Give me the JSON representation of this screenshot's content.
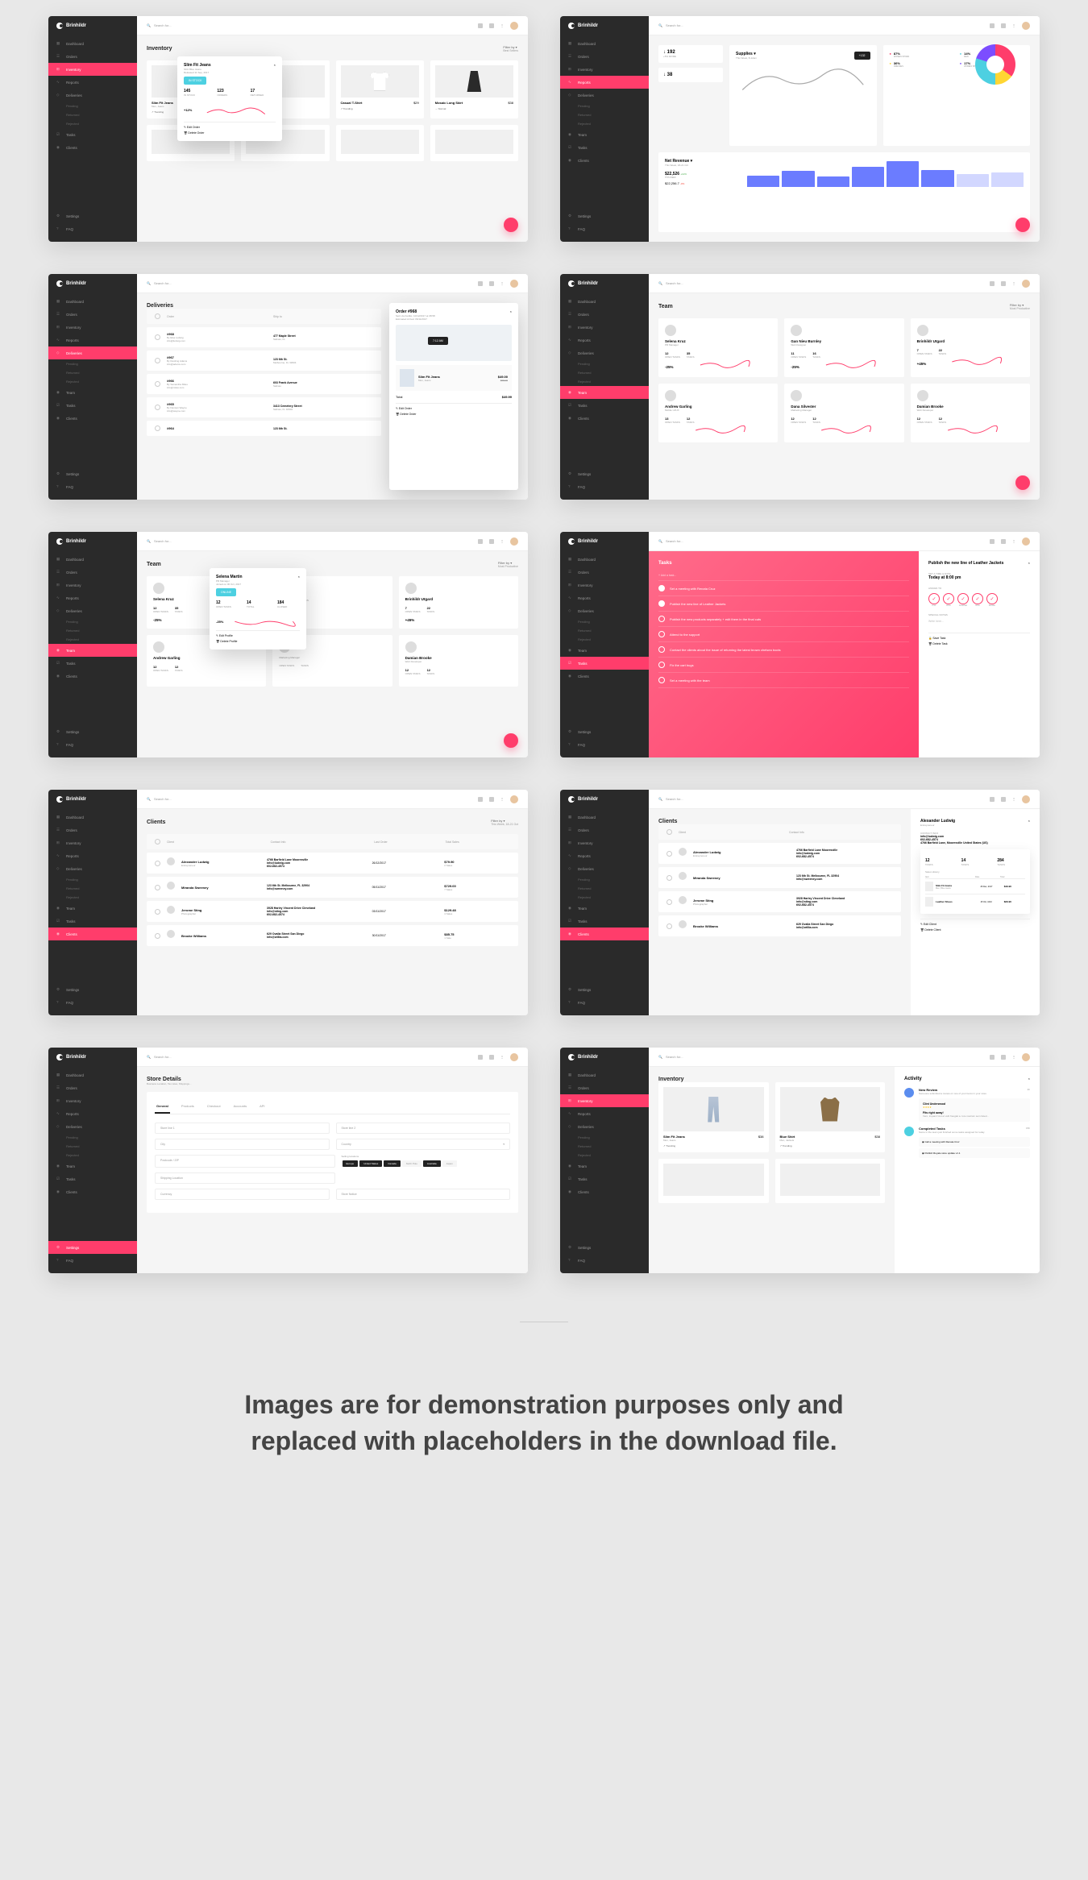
{
  "brand": "Brinhildr",
  "search_placeholder": "Search for...",
  "nav": {
    "dashboard": "Dashboard",
    "orders": "Orders",
    "inventory": "Inventory",
    "reports": "Reports",
    "deliveries": "Deliveries",
    "pending": "Pending",
    "returned": "Returned",
    "rejected": "Rejected",
    "team": "Team",
    "tasks": "Tasks",
    "clients": "Clients",
    "settings": "Settings",
    "faq": "FAQ"
  },
  "filter_label": "Filter by",
  "screens": {
    "s1": {
      "title": "Inventory",
      "filter_sub": "Best Sellers",
      "popup": {
        "name": "Slim Fit Jeans",
        "sku": "SKU Blue Jeans",
        "released": "Released 11 Sep, 2017",
        "badge": "IN STOCK",
        "stats": [
          {
            "val": "145",
            "lbl": "IN STOCK"
          },
          {
            "val": "123",
            "lbl": "ORDERS"
          },
          {
            "val": "17",
            "lbl": "RETURNED"
          }
        ],
        "trend": "+12%",
        "actions": [
          "Edit Order",
          "Delete Order"
        ]
      },
      "products": [
        {
          "name": "Slim Fit Jeans",
          "sub": "Men, Jeans",
          "price": "$38",
          "trend": "Trending"
        },
        {
          "name": "",
          "sub": "",
          "price": "",
          "trend": ""
        },
        {
          "name": "Casual T-Shirt",
          "sub": "",
          "price": "$29",
          "trend": "Trending"
        },
        {
          "name": "Mosaic Long Skirt",
          "sub": "",
          "price": "$38",
          "trend": "Normal"
        }
      ]
    },
    "s2": {
      "cards": [
        {
          "val": "192",
          "trend": "+5% MORE"
        },
        {
          "title": "Supplies",
          "sub": "This Week, 8-12am",
          "val": "+132",
          "trend": ""
        },
        {
          "val": "38",
          "trend": ""
        }
      ],
      "donut_stats": [
        {
          "pct": "87%",
          "lbl": "WOMEN SHOES",
          "color": "#ff3d6b"
        },
        {
          "pct": "36%",
          "lbl": "DRESSES",
          "color": "#ffd633"
        },
        {
          "pct": "14%",
          "lbl": "MEN",
          "color": "#4dd0e1"
        },
        {
          "pct": "17%",
          "lbl": "WOMEN SHIRTS",
          "color": "#7c4dff"
        }
      ],
      "revenue": {
        "title": "Net Revenue",
        "sub": "This Week, 18-21 Oct",
        "val": "$22,526",
        "trend": "+12%",
        "prev": "$22,256.7",
        "prev_trend": "-3%"
      }
    },
    "s3": {
      "title": "Deliveries",
      "cols": [
        "Order",
        "Ship to"
      ],
      "orders": [
        {
          "id": "#968",
          "by": "By Elsa Ludwig",
          "email": "info@ludwig.com",
          "addr": "477 Maple Street",
          "city": "Salinas, FL",
          "zip": ""
        },
        {
          "id": "#967",
          "by": "By Dustling Adams",
          "email": "info@adams.com",
          "addr": "123 6th St.",
          "city": "Melbourne, FL 32904",
          "zip": ""
        },
        {
          "id": "#966",
          "by": "By Samantha Miles",
          "email": "info@miles.com",
          "addr": "603 Frank Avenue",
          "city": "Salinas",
          "zip": ""
        },
        {
          "id": "#965",
          "by": "By Damian Wayne",
          "email": "info@wayne.com",
          "addr": "3413 Cemetery Street",
          "city": "Salinas, FL 32904",
          "zip": ""
        },
        {
          "id": "#964",
          "by": "",
          "email": "",
          "addr": "123 6th St.",
          "city": "",
          "zip": ""
        }
      ],
      "detail": {
        "title": "Order #968",
        "sent": "Sent via FedEx, 10/12/2017 at 08:58",
        "est": "Estimated Arrival: 06/11/2017",
        "map_time": "7:12 AM",
        "item": {
          "name": "Slim Fit Jeans",
          "sub": "Men, Jeans",
          "price": "$49.00",
          "old": "$68.00"
        },
        "total_lbl": "Total",
        "total": "$49.99",
        "actions": [
          "Edit Order",
          "Delete Order"
        ]
      }
    },
    "s4": {
      "title": "Team",
      "filter_sub": "Most Productive",
      "members": [
        {
          "name": "Selena Kruz",
          "role": "PR Manager",
          "open": "12",
          "tasks": "35",
          "pct": "-25%",
          "pct_sub": "Last Week"
        },
        {
          "name": "Gan Nieu Burnley",
          "role": "Web Designer",
          "open": "11",
          "tasks": "16",
          "pct": "-25%",
          "pct_sub": "Last Week"
        },
        {
          "name": "Brinhildr Utgard",
          "role": "",
          "open": "7",
          "tasks": "22",
          "pct": "+45%",
          "pct_sub": "Last Week"
        },
        {
          "name": "Andrew Garling",
          "role": "Mobile UI/UX",
          "open": "13",
          "tasks": "12",
          "pct": "",
          "pct_sub": ""
        },
        {
          "name": "Dana Silvester",
          "role": "Marketing Manager",
          "open": "12",
          "tasks": "12",
          "pct": "",
          "pct_sub": ""
        },
        {
          "name": "Damian Brooke",
          "role": "Web Developer",
          "open": "12",
          "tasks": "12",
          "pct": "",
          "pct_sub": ""
        }
      ]
    },
    "s5": {
      "title": "Team",
      "filter_sub": "Most Productive",
      "popup": {
        "name": "Selena Martin",
        "role": "PR Manager",
        "joined": "Joined on 30 Oct, 2017",
        "badge": "ONLINE",
        "stats": [
          {
            "val": "12",
            "lbl": "OPEN TASKS"
          },
          {
            "val": "14",
            "lbl": "TOTAL"
          },
          {
            "val": "184",
            "lbl": "CLOSED"
          }
        ],
        "trend": "-25%",
        "actions": [
          "Edit Profile",
          "Delete Profile"
        ]
      },
      "members": [
        {
          "name": "Selena Kruz",
          "role": "",
          "open": "12",
          "tasks": "35",
          "pct": "-25%"
        },
        {
          "name": "",
          "role": "",
          "open": "",
          "tasks": "",
          "pct": ""
        },
        {
          "name": "Brinhildr Utgard",
          "role": "",
          "open": "7",
          "tasks": "22",
          "pct": "+45%"
        },
        {
          "name": "Andrew Garling",
          "role": "",
          "open": "12",
          "tasks": "12",
          "pct": ""
        },
        {
          "name": "",
          "role": "Marketing Manager",
          "open": "",
          "tasks": "",
          "pct": ""
        },
        {
          "name": "Damian Brooke",
          "role": "Web Developer",
          "open": "12",
          "tasks": "12",
          "pct": ""
        }
      ]
    },
    "s6": {
      "title": "Tasks",
      "add_placeholder": "Add a task...",
      "tasks": [
        {
          "text": "Set a meeting with Renata Cruz",
          "done": true
        },
        {
          "text": "Publish the new line of Leather Jackets",
          "done": true
        },
        {
          "text": "Publish the new products separately + edit them in the final cuts",
          "done": false
        },
        {
          "text": "Attend to the support",
          "done": false
        },
        {
          "text": "Contact the clients about the issue of returning the latest brown chelsea boots",
          "done": false
        },
        {
          "text": "Fix the cart bugs",
          "done": false
        },
        {
          "text": "Set a meeting with the team",
          "done": false
        }
      ],
      "panel": {
        "title": "Publish the new line of Leather Jackets",
        "date_lbl": "SET A TIME & DATE",
        "date": "Today at 8:00 pm",
        "assign_lbl": "ASSIGN TO",
        "people": [
          "Kruz",
          "Dina",
          "Jonathan",
          "Nina",
          "Brooke"
        ],
        "notes_lbl": "SPECIAL NOTES",
        "notes_placeholder": "Write here...",
        "actions": [
          "Save Task",
          "Delete Task"
        ]
      }
    },
    "s7": {
      "title": "Clients",
      "filter_sub": "This Week, 18-21 Oct",
      "cols": [
        "Client",
        "Contact Info",
        "Last Order",
        "Total Sales"
      ],
      "clients": [
        {
          "name": "Alexander Ludwig",
          "role": "Entrepreneur",
          "addr": "4766 Barfield Lane Mooresville",
          "email": "info@ludwig.com",
          "phone": "602-682-4574",
          "date": "26/12/2017",
          "sales": "$79.90",
          "items": "2 Sales"
        },
        {
          "name": "Miranda Sweeney",
          "role": "",
          "addr": "123 6th St. Melbourne, FL 32904",
          "email": "info@sweeney.com",
          "phone": "",
          "date": "05/11/2017",
          "sales": "$729.00",
          "items": "7 Sales"
        },
        {
          "name": "Jerome Sting",
          "role": "Photographer",
          "addr": "3928 Harley Vincent Drive Cleveland",
          "email": "info@sting.com",
          "phone": "602-682-4574",
          "date": "03/11/2017",
          "sales": "$129.48",
          "items": "4 Sales"
        },
        {
          "name": "Brooke Williams",
          "role": "",
          "addr": "629 Ovalla Street San Diego",
          "email": "info@willia.com",
          "phone": "",
          "date": "30/11/2017",
          "sales": "$85.75",
          "items": "1 Sale"
        }
      ]
    },
    "s8": {
      "title": "Clients",
      "cols": [
        "Client",
        "Contact Info"
      ],
      "clients": [
        {
          "name": "Alexander Ludwig",
          "role": "Entrepreneur",
          "addr": "4766 Barfield Lane Mooresville",
          "email": "info@ludwig.com",
          "phone": "602-682-4574"
        },
        {
          "name": "Miranda Sweeney",
          "role": "",
          "addr": "123 6th St. Melbourne, FL 32904",
          "email": "info@sweeney.com",
          "phone": ""
        },
        {
          "name": "Jerome Sting",
          "role": "Photographer",
          "addr": "3928 Harley Vincent Drive Cleveland",
          "email": "info@sting.com",
          "phone": "602-682-4574"
        },
        {
          "name": "Brooke Williams",
          "role": "",
          "addr": "629 Ovalla Street San Diego",
          "email": "info@willia.com",
          "phone": ""
        }
      ],
      "panel": {
        "name": "Alexander Ludwig",
        "role": "Entrepreneur",
        "contact_lbl": "CONTACT INFO",
        "email": "info@ludwig.com",
        "phone": "602-682-4574",
        "addr": "4766 Barfield Lane, Mooresville United States (US)",
        "stats": [
          {
            "val": "12",
            "lbl": "Tasks"
          },
          {
            "val": "14",
            "lbl": "Tasks"
          },
          {
            "val": "284",
            "lbl": "Tasks"
          }
        ],
        "history_lbl": "Sales History",
        "history_cols": [
          "Item",
          "Date",
          "Total"
        ],
        "history": [
          {
            "item": "Slim Fit Jeans",
            "sub": "Men, Blue Jeans",
            "date": "26 Dec, 2017",
            "total": "$49.90"
          },
          {
            "item": "Leather Shoes",
            "sub": "",
            "date": "15 Oct, 1010",
            "total": "$29.90"
          }
        ],
        "actions": [
          "Edit Client",
          "Delete Client"
        ]
      }
    },
    "s9": {
      "title": "Store Details",
      "subtitle": "Business Location, Tax rates, Shippings...",
      "tabs": [
        "General",
        "Products",
        "Checkout",
        "Accounts",
        "API"
      ],
      "fields": {
        "line1": "Store line 1",
        "line2": "Store line 2",
        "city": "City",
        "country": "Country",
        "postcode": "Postcode / ZIP",
        "selling": "Selling locations",
        "shipping": "Shipping Location",
        "currency": "Currency",
        "notice": "Store Notice"
      },
      "tags": [
        "Europe",
        "United States",
        "Canada",
        "North Pole",
        "Australia",
        "Japan"
      ]
    },
    "s10": {
      "title": "Inventory",
      "products": [
        {
          "name": "Slim Fit Jeans",
          "sub": "Men, Jeans",
          "price": "$38",
          "trend": "Trending"
        },
        {
          "name": "Blue Shirt",
          "sub": "Men, Jackets",
          "price": "$38",
          "trend": "Trending"
        }
      ],
      "activity": {
        "title": "Activity",
        "items": [
          {
            "type": "review",
            "title": "New Review",
            "time": "2h",
            "desc": "Someone submitted a review on one of your items in your store",
            "user": "Clint Underwood",
            "stars": "★★★★",
            "quote": "Fits right away!",
            "quote_sub": "Vero, inquam! Aut et velit freugiat a. Iure nostrum sem listed..."
          },
          {
            "type": "tasks",
            "title": "Completed Tasks",
            "time": "15h",
            "desc": "Some in the team just finished some tasks assigned for today",
            "subtasks": [
              "Call a meeting with Renata Cruz",
              "Publish Royale store update v1.1"
            ]
          }
        ]
      }
    }
  },
  "footer": "Images are for demonstration purposes only and replaced with placeholders in the download file."
}
